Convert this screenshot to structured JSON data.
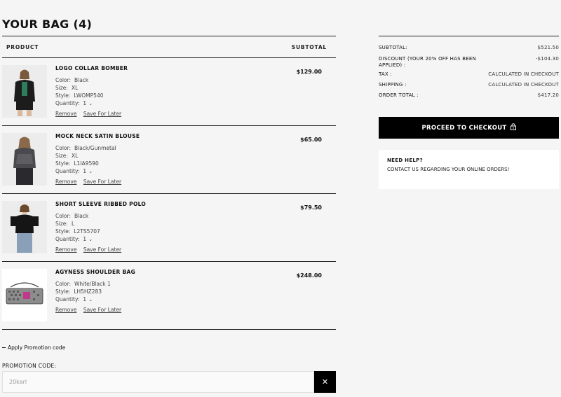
{
  "bag": {
    "title": "YOUR BAG (4)",
    "col_product": "PRODUCT",
    "col_subtotal": "SUBTOTAL",
    "remove_label": "Remove",
    "save_label": "Save For Later",
    "items": [
      {
        "name": "LOGO COLLAR BOMBER",
        "price": "$129.00",
        "attrs": [
          {
            "k": "Color:",
            "v": "Black"
          },
          {
            "k": "Size:",
            "v": "XL"
          },
          {
            "k": "Style:",
            "v": "LWOMP540"
          },
          {
            "k": "Quantity:",
            "v": "1"
          }
        ]
      },
      {
        "name": "MOCK NECK SATIN BLOUSE",
        "price": "$65.00",
        "attrs": [
          {
            "k": "Color:",
            "v": "Black/Gunmetal"
          },
          {
            "k": "Size:",
            "v": "XL"
          },
          {
            "k": "Style:",
            "v": "L1IA9590"
          },
          {
            "k": "Quantity:",
            "v": "1"
          }
        ]
      },
      {
        "name": "SHORT SLEEVE RIBBED POLO",
        "price": "$79.50",
        "attrs": [
          {
            "k": "Color:",
            "v": "Black"
          },
          {
            "k": "Size:",
            "v": "L"
          },
          {
            "k": "Style:",
            "v": "L2TS5707"
          },
          {
            "k": "Quantity:",
            "v": "1"
          }
        ]
      },
      {
        "name": "AGYNESS SHOULDER BAG",
        "price": "$248.00",
        "attrs": [
          {
            "k": "Color:",
            "v": "White/Black 1"
          },
          {
            "k": "Style:",
            "v": "LH5HZ283"
          },
          {
            "k": "Quantity:",
            "v": "1"
          }
        ]
      }
    ]
  },
  "promo": {
    "toggle_label": "Apply Promotion code",
    "field_label": "PROMOTION CODE:",
    "value": "20karl",
    "clear_icon": "close-icon"
  },
  "summary": {
    "subtotal_label": "SUBTOTAL:",
    "subtotal_value": "$521.50",
    "discount_label": "DISCOUNT (YOUR 20% OFF HAS BEEN APPLIED) :",
    "discount_value": "-$104.30",
    "tax_label": "TAX :",
    "tax_value": "CALCULATED IN CHECKOUT",
    "shipping_label": "SHIPPING :",
    "shipping_value": "CALCULATED IN CHECKOUT",
    "total_label": "ORDER TOTAL :",
    "total_value": "$417.20"
  },
  "checkout": {
    "label": "PROCEED TO CHECKOUT",
    "icon": "lock-icon"
  },
  "help": {
    "title": "NEED HELP?",
    "link": "CONTACT US REGARDING YOUR ONLINE ORDERS!"
  },
  "colors": {
    "accent": "#000000",
    "background": "#f5f5f5",
    "panel": "#ffffff"
  }
}
